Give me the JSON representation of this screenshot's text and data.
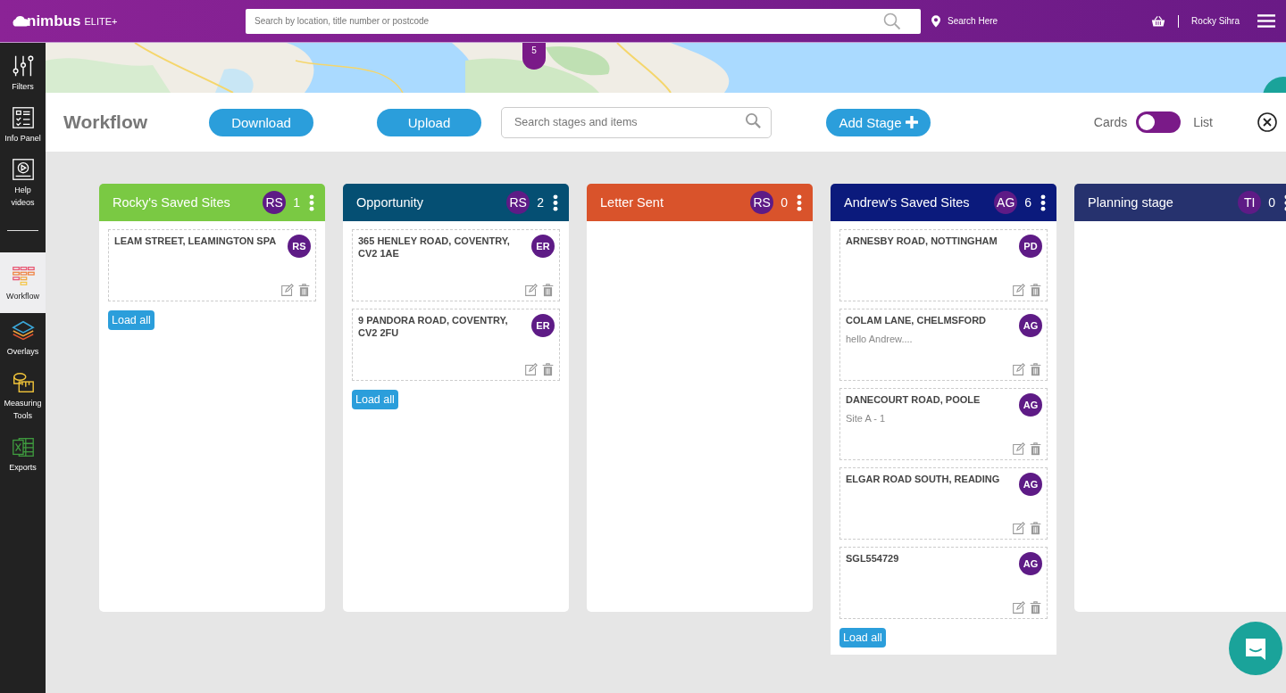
{
  "header": {
    "logo": "nimbus",
    "logo_tag": "ELITE+",
    "search": {
      "placeholder": "Search by location, title number or postcode"
    },
    "search_here": "Search Here",
    "user": "Rocky Sihra"
  },
  "sidebar": {
    "items": [
      {
        "label": "Filters",
        "selected": false
      },
      {
        "label": "Info Panel",
        "selected": false
      },
      {
        "label": "Help videos",
        "selected": false
      },
      {
        "label": "Workflow",
        "selected": true
      },
      {
        "label": "Overlays",
        "selected": false
      },
      {
        "label": "Measuring Tools",
        "selected": false
      },
      {
        "label": "Exports",
        "selected": false
      }
    ]
  },
  "map": {
    "marker_count": "5"
  },
  "toolbar": {
    "title": "Workflow",
    "download": "Download",
    "upload": "Upload",
    "search": {
      "placeholder": "Search stages and items"
    },
    "add_stage": "Add Stage",
    "view_left": "Cards",
    "view_right": "List",
    "list_view": false
  },
  "columns": [
    {
      "title": "Rocky's Saved Sites",
      "color": "#7ac943",
      "owner": "RS",
      "count": "1",
      "load_all": "Load all",
      "items": [
        {
          "title": "LEAM STREET, LEAMINGTON SPA",
          "assignee": "RS"
        }
      ]
    },
    {
      "title": "Opportunity",
      "color": "#054f73",
      "owner": "RS",
      "count": "2",
      "load_all": "Load all",
      "items": [
        {
          "title": "365 HENLEY ROAD, COVENTRY, CV2 1AE",
          "assignee": "ER"
        },
        {
          "title": "9 PANDORA ROAD, COVENTRY, CV2 2FU",
          "assignee": "ER"
        }
      ]
    },
    {
      "title": "Letter Sent",
      "color": "#d9532b",
      "owner": "RS",
      "count": "0"
    },
    {
      "title": "Andrew's Saved Sites",
      "color": "#0b1a7c",
      "owner": "AG",
      "count": "6",
      "load_all": "Load all",
      "items": [
        {
          "title": "ARNESBY ROAD, NOTTINGHAM",
          "assignee": "PD"
        },
        {
          "title": "COLAM LANE, CHELMSFORD",
          "note": "hello Andrew....",
          "assignee": "AG"
        },
        {
          "title": "DANECOURT ROAD, POOLE",
          "note": "Site A - 1",
          "assignee": "AG"
        },
        {
          "title": "ELGAR ROAD SOUTH, READING",
          "assignee": "AG"
        },
        {
          "title": "SGL554729",
          "assignee": "AG"
        }
      ]
    },
    {
      "title": "Planning stage",
      "color": "#26326e",
      "owner": "TI",
      "count": "0"
    }
  ]
}
